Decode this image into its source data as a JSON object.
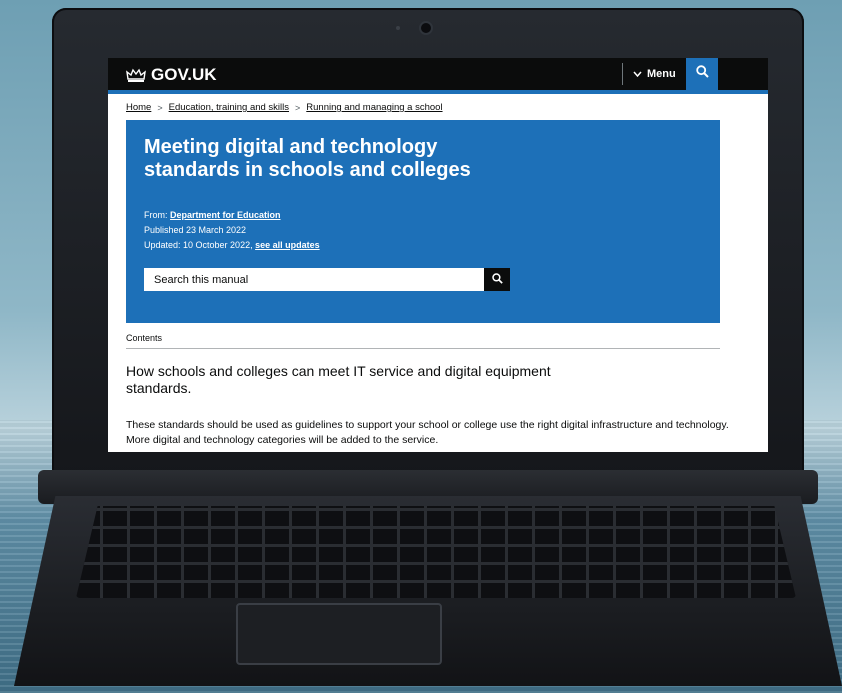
{
  "header": {
    "logo_text": "GOV.UK",
    "logo_icon": "crown-icon",
    "menu_label": "Menu",
    "search_icon": "search-icon"
  },
  "breadcrumb": [
    {
      "label": "Home"
    },
    {
      "label": "Education, training and skills"
    },
    {
      "label": "Running and managing a school"
    }
  ],
  "hero": {
    "title": "Meeting digital and technology standards in schools and colleges",
    "from_prefix": "From:",
    "from_link": "Department for Education",
    "published": "Published 23 March 2022",
    "updated_prefix": "Updated: 10 October 2022,",
    "updated_link": "see all updates",
    "search_placeholder": "Search this manual"
  },
  "contents_label": "Contents",
  "lead": "How schools and colleges can meet IT service and digital equipment standards.",
  "body": "These standards should be used as guidelines to support your school or college use the right digital infrastructure and technology. More digital and technology categories will be added to the service.",
  "colors": {
    "header_bg": "#0b0c0c",
    "brand_blue": "#1d70b8",
    "text": "#0b0c0c",
    "white": "#ffffff"
  }
}
